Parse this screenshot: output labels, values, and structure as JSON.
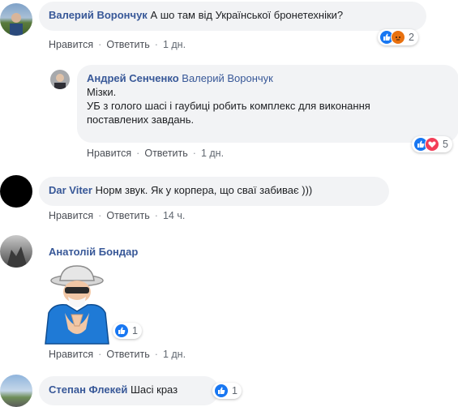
{
  "comments": [
    {
      "author": "Валерий Ворончук",
      "text": "А шо там від Української бронетехніки?",
      "like": "Нравится",
      "reply": "Ответить",
      "time": "1 дн.",
      "reactions": {
        "icons": [
          "like-icon",
          "angry-icon"
        ],
        "count": "2"
      }
    },
    {
      "author": "Андрей Сенченко",
      "mention": "Валерий Ворончук",
      "line1": "Мізки.",
      "line2": "УБ з голого шасі і гаубиці робить комплекс для виконання",
      "line3": "поставлених завдань.",
      "like": "Нравится",
      "reply": "Ответить",
      "time": "1 дн.",
      "reactions": {
        "icons": [
          "like-icon",
          "love-icon"
        ],
        "count": "5"
      }
    },
    {
      "author": "Dar Viter",
      "text": "Норм звук. Як у корпера, що сваї забиває )))",
      "like": "Нравится",
      "reply": "Ответить",
      "time": "14 ч."
    },
    {
      "author": "Анатолій Бондар",
      "sticker": "clapping-grandpa-sticker",
      "like": "Нравится",
      "reply": "Ответить",
      "time": "1 дн.",
      "reactions": {
        "icons": [
          "like-icon"
        ],
        "count": "1"
      }
    },
    {
      "author": "Степан Флекей",
      "text": "Шасі краз",
      "reactions": {
        "icons": [
          "like-icon"
        ],
        "count": "1"
      }
    }
  ],
  "colors": {
    "author": "#385898",
    "bubble": "#f2f3f5",
    "like": "#1877f2",
    "action": "#606770"
  }
}
